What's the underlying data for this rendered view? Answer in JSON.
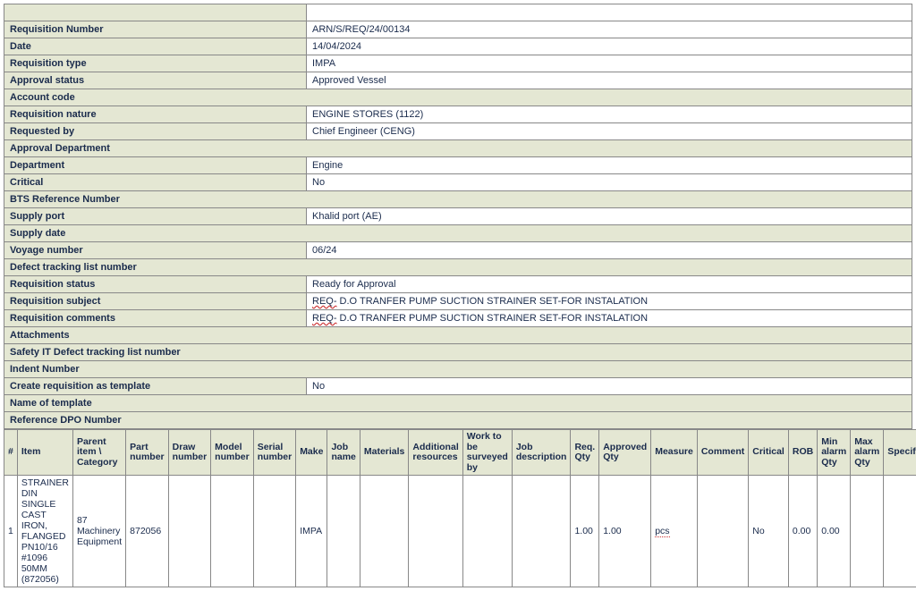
{
  "header_rows": [
    {
      "type": "kv",
      "label": "Requisition Number",
      "value": "ARN/S/REQ/24/00134"
    },
    {
      "type": "kv",
      "label": "Date",
      "value": "14/04/2024"
    },
    {
      "type": "kv",
      "label": "Requisition type",
      "value": "IMPA"
    },
    {
      "type": "kv",
      "label": "Approval status",
      "value": "Approved Vessel"
    },
    {
      "type": "full",
      "label": "Account code"
    },
    {
      "type": "kv",
      "label": "Requisition nature",
      "value": "ENGINE STORES (1122)"
    },
    {
      "type": "kv",
      "label": "Requested by",
      "value": "Chief Engineer (CENG)"
    },
    {
      "type": "full",
      "label": "Approval Department"
    },
    {
      "type": "kv",
      "label": "Department",
      "value": "Engine"
    },
    {
      "type": "kv",
      "label": "Critical",
      "value": "No"
    },
    {
      "type": "full",
      "label": "BTS Reference Number"
    },
    {
      "type": "kv",
      "label": "Supply port",
      "value": "Khalid port (AE)"
    },
    {
      "type": "full",
      "label": "Supply date"
    },
    {
      "type": "kv",
      "label": "Voyage number",
      "value": "06/24"
    },
    {
      "type": "full",
      "label": "Defect tracking list number"
    },
    {
      "type": "kv",
      "label": "Requisition status",
      "value": "Ready for Approval"
    },
    {
      "type": "kv_spell",
      "label": "Requisition subject",
      "prefix": "REQ-",
      "rest": " D.O TRANFER PUMP SUCTION STRAINER SET-FOR INSTALATION"
    },
    {
      "type": "kv_spell",
      "label": "Requisition comments",
      "prefix": "REQ-",
      "rest": " D.O TRANFER PUMP SUCTION STRAINER SET-FOR INSTALATION"
    },
    {
      "type": "full",
      "label": "Attachments"
    },
    {
      "type": "full",
      "label": "Safety IT Defect tracking list number"
    },
    {
      "type": "full",
      "label": "Indent Number"
    },
    {
      "type": "kv",
      "label": "Create requisition as template",
      "value": "No"
    },
    {
      "type": "full",
      "label": "Name of template"
    },
    {
      "type": "full",
      "label": "Reference DPO Number"
    }
  ],
  "item_columns": [
    "#",
    "Item",
    "Parent item \\ Category",
    "Part number",
    "Draw number",
    "Model number",
    "Serial number",
    "Make",
    "Job name",
    "Materials",
    "Additional resources",
    "Work to be surveyed by",
    "Job description",
    "Req. Qty",
    "Approved Qty",
    "Measure",
    "Comment",
    "Critical",
    "ROB",
    "Min alarm Qty",
    "Max alarm Qty",
    "Specifications"
  ],
  "item_rows": [
    {
      "num": "1",
      "item": "STRAINER DIN SINGLE CAST IRON, FLANGED PN10/16 #1096 50MM (872056)",
      "parent": "87 Machinery Equipment",
      "part": "872056",
      "draw": "",
      "model": "",
      "serial": "",
      "make": "IMPA",
      "jobname": "",
      "materials": "",
      "addres": "",
      "survey": "",
      "jobdesc": "",
      "reqqty": "1.00",
      "appqty": "1.00",
      "measure": "pcs",
      "comment": "",
      "critical": "No",
      "rob": "0.00",
      "minalarm": "0.00",
      "maxalarm": "",
      "spec": ""
    }
  ]
}
